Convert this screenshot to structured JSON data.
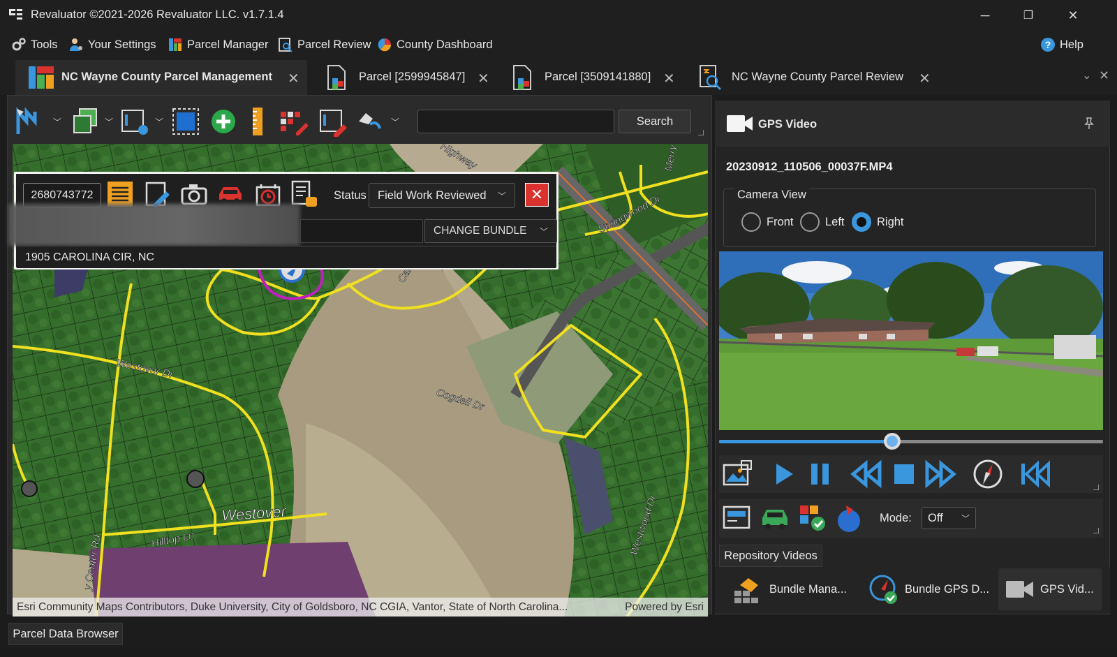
{
  "window": {
    "title": "Revaluator ©2021-2026 Revaluator LLC. v1.7.1.4",
    "controls": {
      "minimize": "─",
      "maximize": "❐",
      "close": "✕"
    }
  },
  "menu": {
    "items": [
      {
        "label": "Tools",
        "icon": "gears-icon"
      },
      {
        "label": "Your Settings",
        "icon": "user-settings-icon"
      },
      {
        "label": "Parcel Manager",
        "icon": "parcel-manager-icon"
      },
      {
        "label": "Parcel Review",
        "icon": "parcel-review-icon"
      },
      {
        "label": "County Dashboard",
        "icon": "county-dashboard-icon"
      }
    ],
    "help": "Help"
  },
  "tabs": [
    {
      "label": "NC Wayne County Parcel Management",
      "active": true
    },
    {
      "label": "Parcel [2599945847]",
      "active": false
    },
    {
      "label": "Parcel [3509141880]",
      "active": false
    },
    {
      "label": "NC Wayne County Parcel Review",
      "active": false
    }
  ],
  "toolbar": {
    "search_placeholder": "",
    "search_label": "Search"
  },
  "popup": {
    "parcel_id": "2680743772",
    "status_label": "Status",
    "status_value": "Field Work Reviewed",
    "change_bundle": "CHANGE BUNDLE",
    "address": "1905 CAROLINA CIR, NC",
    "close": "✕"
  },
  "map": {
    "labels": {
      "springwood": "Springwood Dr",
      "carolina": "Carolina",
      "westover1": "Westover Dr",
      "cogdell": "Cogdell Dr",
      "westover2": "Westover",
      "hilltop": "Hilltop Ln",
      "center": "y Center Rd",
      "westwood": "Westwood Dr",
      "merry": "Merry",
      "highway": "Highway"
    },
    "attribution": "Esri Community Maps Contributors, Duke University, City of Goldsboro, NC CGIA, Vantor, State of North Carolina...",
    "powered_by": "Powered by Esri"
  },
  "gps": {
    "title": "GPS Video",
    "filename": "20230912_110506_00037F.MP4",
    "camera_view_label": "Camera View",
    "camera_options": [
      {
        "label": "Front",
        "selected": false
      },
      {
        "label": "Left",
        "selected": false
      },
      {
        "label": "Right",
        "selected": true
      }
    ],
    "progress": 0.45,
    "mode_label": "Mode:",
    "mode_value": "Off",
    "repository_tab": "Repository Videos"
  },
  "bottom_tabs": [
    {
      "label": "Bundle Mana...",
      "active": false
    },
    {
      "label": "Bundle GPS D...",
      "active": false
    },
    {
      "label": "GPS Vid...",
      "active": true
    }
  ],
  "parcel_data_browser": "Parcel Data Browser",
  "colors": {
    "accent": "#3a96dd",
    "road": "#f0e020",
    "parcel": "#2f6e2a",
    "danger": "#d9322f"
  }
}
